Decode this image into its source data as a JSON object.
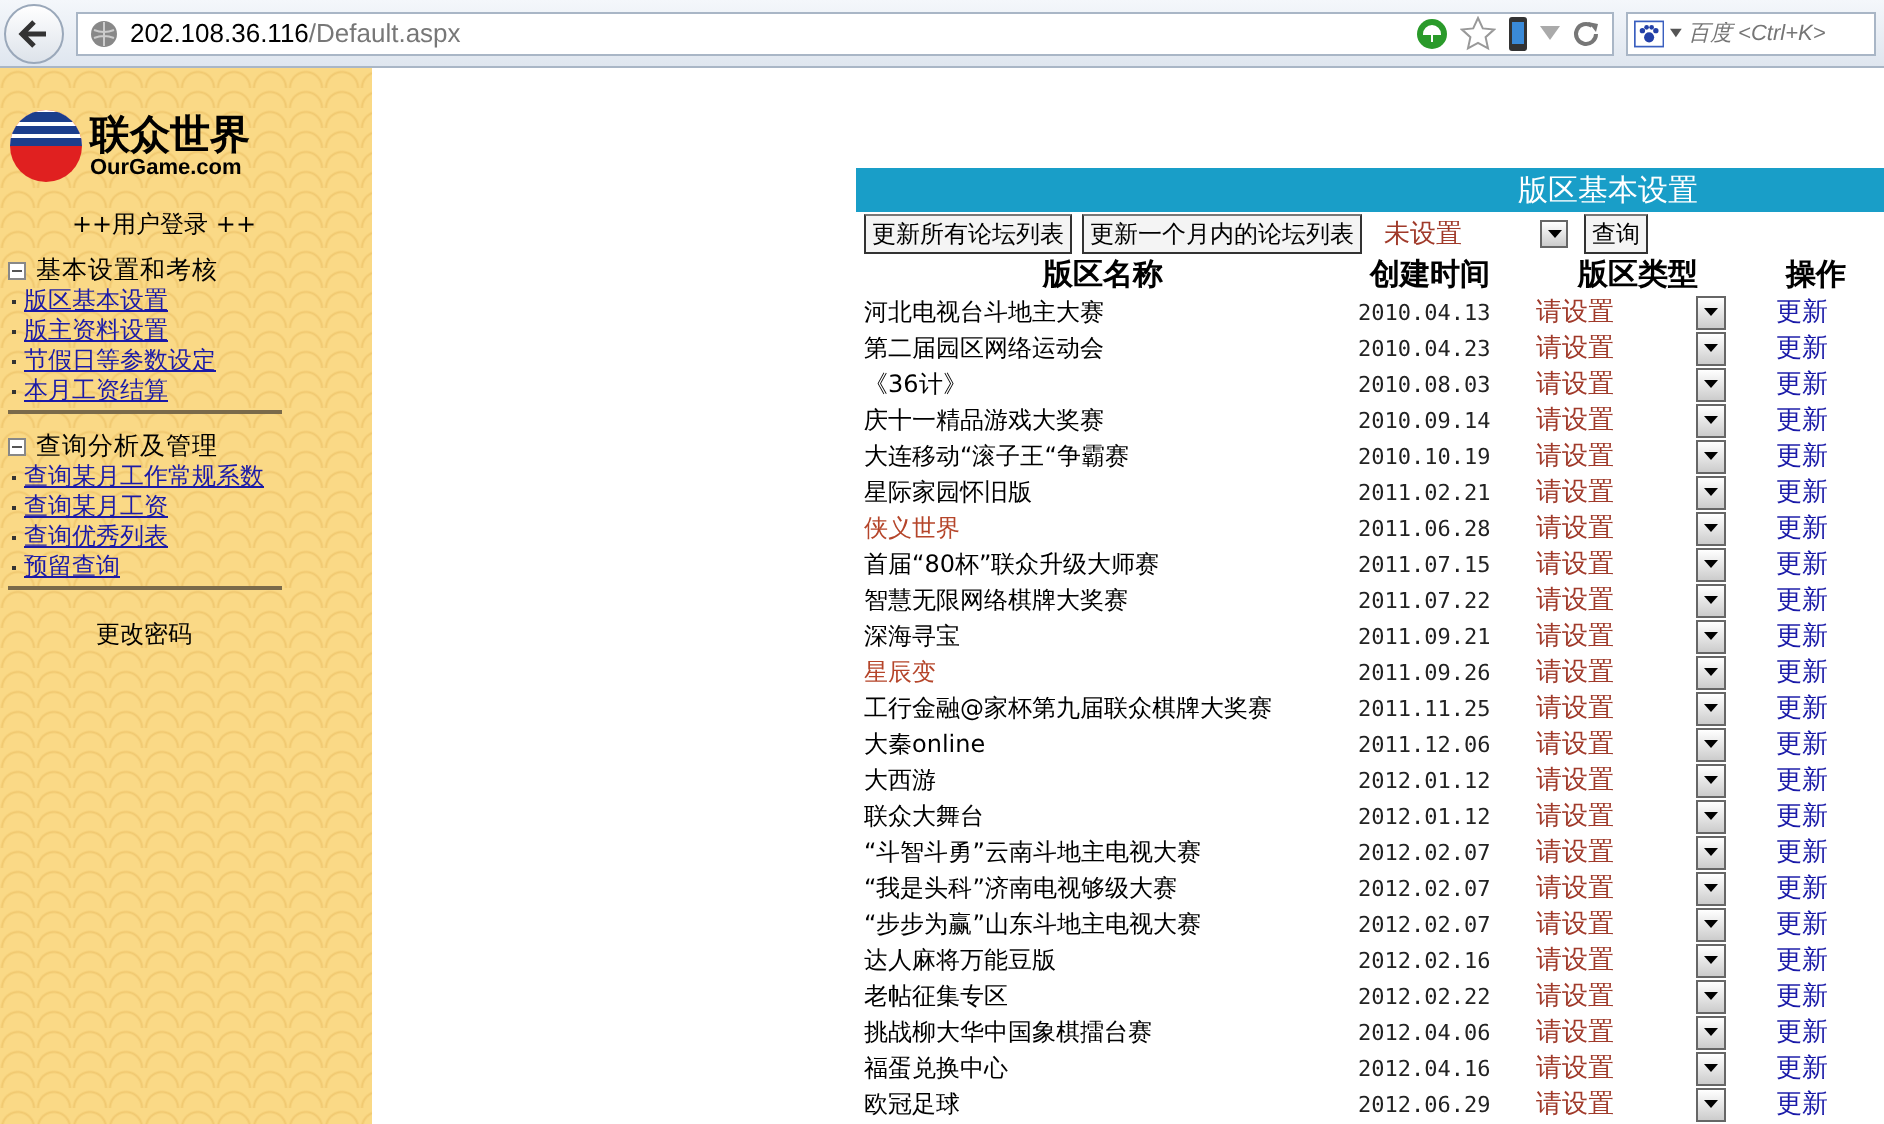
{
  "browser": {
    "url_host": "202.108.36.116",
    "url_path": "/Default.aspx",
    "search_placeholder": "百度 <Ctrl+K>"
  },
  "sidebar": {
    "logo_title": "联众世界",
    "logo_subtitle": "OurGame.com",
    "login": "++用户登录 ++",
    "sections": [
      {
        "title": "基本设置和考核",
        "expanded": true,
        "items": [
          "版区基本设置",
          "版主资料设置",
          "节假日等参数设定",
          "本月工资结算"
        ]
      },
      {
        "title": "查询分析及管理",
        "expanded": true,
        "items": [
          "查询某月工作常规系数",
          "查询某月工资",
          "查询优秀列表",
          "预留查询"
        ]
      }
    ],
    "change_password": "更改密码"
  },
  "panel": {
    "title": "版区基本设置",
    "buttons": [
      "更新所有论坛列表",
      "更新一个月内的论坛列表"
    ],
    "filter_value": "未设置",
    "query_button": "查询",
    "columns": [
      "版区名称",
      "创建时间",
      "版区类型",
      "操作"
    ],
    "rows": [
      {
        "name": "河北电视台斗地主大赛",
        "date": "2010.04.13",
        "type": "请设置",
        "action": "更新",
        "color": "#000000"
      },
      {
        "name": "第二届园区网络运动会",
        "date": "2010.04.23",
        "type": "请设置",
        "action": "更新",
        "color": "#000000"
      },
      {
        "name": "《36计》",
        "date": "2010.08.03",
        "type": "请设置",
        "action": "更新",
        "color": "#000000"
      },
      {
        "name": "庆十一精品游戏大奖赛",
        "date": "2010.09.14",
        "type": "请设置",
        "action": "更新",
        "color": "#000000"
      },
      {
        "name": "大连移动“滚子王“争霸赛",
        "date": "2010.10.19",
        "type": "请设置",
        "action": "更新",
        "color": "#000000"
      },
      {
        "name": "星际家园怀旧版",
        "date": "2011.02.21",
        "type": "请设置",
        "action": "更新",
        "color": "#000000"
      },
      {
        "name": "侠义世界",
        "date": "2011.06.28",
        "type": "请设置",
        "action": "更新",
        "color": "#b5452a"
      },
      {
        "name": "首届“80杯”联众升级大师赛",
        "date": "2011.07.15",
        "type": "请设置",
        "action": "更新",
        "color": "#000000"
      },
      {
        "name": "智慧无限网络棋牌大奖赛",
        "date": "2011.07.22",
        "type": "请设置",
        "action": "更新",
        "color": "#000000"
      },
      {
        "name": "深海寻宝",
        "date": "2011.09.21",
        "type": "请设置",
        "action": "更新",
        "color": "#000000"
      },
      {
        "name": "星辰变",
        "date": "2011.09.26",
        "type": "请设置",
        "action": "更新",
        "color": "#b5452a"
      },
      {
        "name": "工行金融@家杯第九届联众棋牌大奖赛",
        "date": "2011.11.25",
        "type": "请设置",
        "action": "更新",
        "color": "#000000"
      },
      {
        "name": "大秦online",
        "date": "2011.12.06",
        "type": "请设置",
        "action": "更新",
        "color": "#000000"
      },
      {
        "name": "大西游",
        "date": "2012.01.12",
        "type": "请设置",
        "action": "更新",
        "color": "#000000"
      },
      {
        "name": "联众大舞台",
        "date": "2012.01.12",
        "type": "请设置",
        "action": "更新",
        "color": "#000000"
      },
      {
        "name": "“斗智斗勇”云南斗地主电视大赛",
        "date": "2012.02.07",
        "type": "请设置",
        "action": "更新",
        "color": "#000000"
      },
      {
        "name": "“我是头科”济南电视够级大赛",
        "date": "2012.02.07",
        "type": "请设置",
        "action": "更新",
        "color": "#000000"
      },
      {
        "name": "“步步为赢”山东斗地主电视大赛",
        "date": "2012.02.07",
        "type": "请设置",
        "action": "更新",
        "color": "#000000"
      },
      {
        "name": "达人麻将万能豆版",
        "date": "2012.02.16",
        "type": "请设置",
        "action": "更新",
        "color": "#000000"
      },
      {
        "name": "老帖征集专区",
        "date": "2012.02.22",
        "type": "请设置",
        "action": "更新",
        "color": "#000000"
      },
      {
        "name": "挑战柳大华中国象棋擂台赛",
        "date": "2012.04.06",
        "type": "请设置",
        "action": "更新",
        "color": "#000000"
      },
      {
        "name": "福蛋兑换中心",
        "date": "2012.04.16",
        "type": "请设置",
        "action": "更新",
        "color": "#000000"
      },
      {
        "name": "欧冠足球",
        "date": "2012.06.29",
        "type": "请设置",
        "action": "更新",
        "color": "#000000"
      }
    ]
  }
}
